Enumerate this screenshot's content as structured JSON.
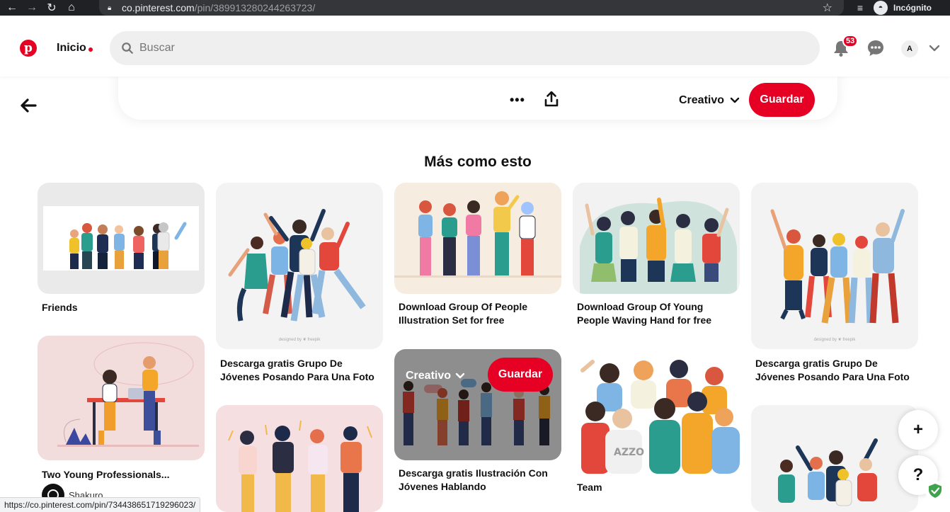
{
  "browser": {
    "url_host": "co.pinterest.com",
    "url_path": "/pin/389913280244263723/",
    "incognito_label": "Incógnito"
  },
  "header": {
    "home_label": "Inicio",
    "search_placeholder": "Buscar",
    "notifications_count": "53",
    "avatar_initial": "A"
  },
  "closeup": {
    "more_label": "•••",
    "board_label": "Creativo",
    "save_label": "Guardar"
  },
  "section_title": "Más como esto",
  "pins": [
    {
      "title": "Friends"
    },
    {
      "title": "Descarga gratis Grupo De Jóvenes Posando Para Una Foto",
      "credit": "designed by ❦ freepik"
    },
    {
      "title": "Download Group Of People Illustration Set for free"
    },
    {
      "title": "Download Group Of Young People Waving Hand for free"
    },
    {
      "title": "Descarga gratis Grupo De Jóvenes Posando Para Una Foto",
      "credit": "designed by ❦ freepik"
    },
    {
      "title": "Two Young Professionals...",
      "creator": "Shakuro"
    },
    {
      "title": ""
    },
    {
      "title": "Descarga gratis Ilustración Con Jóvenes Hablando",
      "hover_board": "Creativo",
      "hover_save": "Guardar"
    },
    {
      "title": "Team"
    },
    {
      "title": ""
    }
  ],
  "fab": {
    "plus": "+",
    "help": "?"
  },
  "status_url": "https://co.pinterest.com/pin/734438651719296023/",
  "colors": {
    "brand": "#e60023",
    "chrome": "#202124"
  }
}
